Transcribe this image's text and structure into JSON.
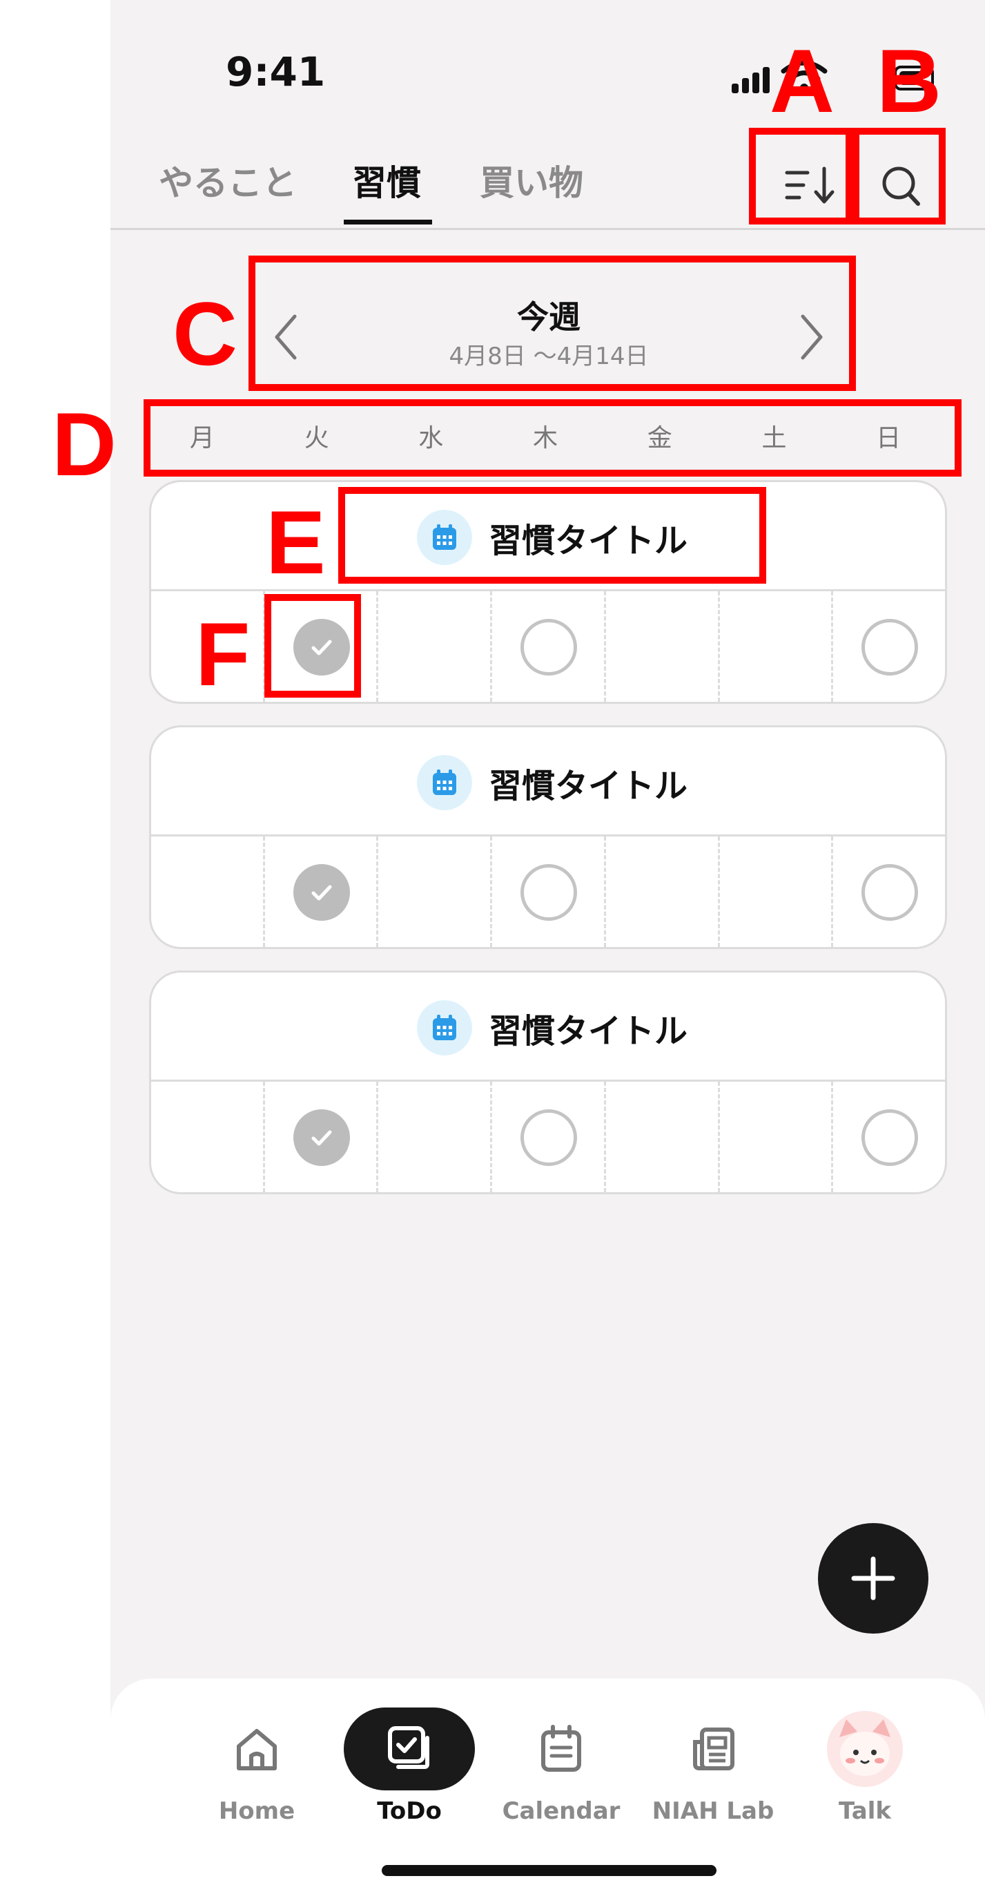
{
  "status": {
    "time": "9:41"
  },
  "tabs": [
    {
      "label": "やること",
      "active": false
    },
    {
      "label": "習慣",
      "active": true
    },
    {
      "label": "買い物",
      "active": false
    }
  ],
  "icons": {
    "sort": "sort-descending-icon",
    "search": "search-icon"
  },
  "week": {
    "title": "今週",
    "range": "4月8日 〜4月14日"
  },
  "weekdays": [
    "月",
    "火",
    "水",
    "木",
    "金",
    "土",
    "日"
  ],
  "habits": [
    {
      "title": "習慣タイトル",
      "cells": [
        "none",
        "done",
        "none",
        "open",
        "none",
        "none",
        "open"
      ]
    },
    {
      "title": "習慣タイトル",
      "cells": [
        "none",
        "done",
        "none",
        "open",
        "none",
        "none",
        "open"
      ]
    },
    {
      "title": "習慣タイトル",
      "cells": [
        "none",
        "done",
        "none",
        "open",
        "none",
        "none",
        "open"
      ]
    }
  ],
  "nav": [
    {
      "label": "Home",
      "active": false
    },
    {
      "label": "ToDo",
      "active": true
    },
    {
      "label": "Calendar",
      "active": false
    },
    {
      "label": "NIAH Lab",
      "active": false
    },
    {
      "label": "Talk",
      "active": false
    }
  ],
  "annotations": {
    "A": "A",
    "B": "B",
    "C": "C",
    "D": "D",
    "E": "E",
    "F": "F"
  },
  "colors": {
    "accent": "#ff0000",
    "calendar_icon": "#2b9be8",
    "fab": "#1a1a1a",
    "background": "#f4f2f3"
  }
}
